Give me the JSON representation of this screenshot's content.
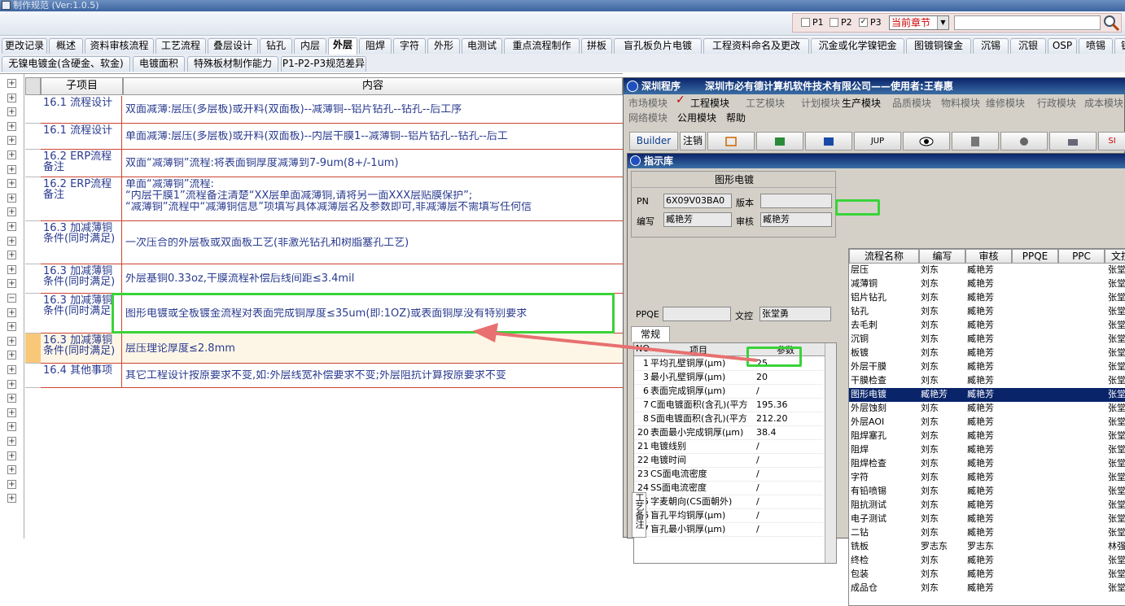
{
  "window": {
    "title": "制作规范 (Ver:1.0.5)"
  },
  "filter": {
    "p1": "P1",
    "p2": "P2",
    "p3": "P3",
    "p3_checked": "✓",
    "chapter_select": "当前章节",
    "search_value": ""
  },
  "tabs_row1": [
    "更改记录",
    "概述",
    "资料审核流程",
    "工艺流程",
    "叠层设计",
    "钻孔",
    "内层",
    "外层",
    "阻焊",
    "字符",
    "外形",
    "电测试",
    "重点流程制作",
    "拼板",
    "盲孔板负片电镀",
    "工程资料命名及更改",
    "沉金或化学镍钯金",
    "图镀铜镍金",
    "沉锡",
    "沉银",
    "OSP",
    "喷锡",
    "镀硬金"
  ],
  "active_tab": "外层",
  "tabs_row2": [
    "无镍电镀金(含硬金、软金)",
    "电镀面积",
    "特殊板材制作能力",
    "P1-P2-P3规范差异"
  ],
  "grid": {
    "col_item": "子项目",
    "col_content": "内容",
    "rows": [
      {
        "item": "16.1 流程设计",
        "content": "双面减薄:层压(多层板)或开料(双面板)--减薄铜--铝片钻孔--钻孔--后工序"
      },
      {
        "item": "16.1 流程设计",
        "content": "单面减薄:层压(多层板)或开料(双面板)--内层干膜1--减薄铜--铝片钻孔--钻孔--后工"
      },
      {
        "item": "16.2 ERP流程备注",
        "content": "双面“减薄铜”流程:将表面铜厚度减薄到7-9um(8+/-1um)"
      },
      {
        "item": "16.2 ERP流程备注",
        "content": "单面“减薄铜”流程:",
        "content2": "“内层干膜1”流程备注清楚“XX层单面减薄铜,请将另一面XXX层贴膜保护”;",
        "content3": "“减薄铜”流程中“减薄铜信息”项填写具体减薄层名及参数即可,非减薄层不需填写任何信"
      },
      {
        "item": "16.3 加减薄铜条件(同时满足)",
        "content": "一次压合的外层板或双面板工艺(非激光钻孔和树脂塞孔工艺)"
      },
      {
        "item": "16.3 加减薄铜条件(同时满足)",
        "content": "外层基铜0.33oz,干膜流程补偿后线间距≤3.4mil"
      },
      {
        "item": "16.3 加减薄铜条件(同时满足)",
        "content": "图形电镀或全板镀金流程对表面完成铜厚度≤35um(即:1OZ)或表面铜厚没有特别要求"
      },
      {
        "item": "16.3 加减薄铜条件(同时满足)",
        "content": "层压理论厚度≤2.8mm"
      },
      {
        "item": "16.4 其他事项",
        "content": "其它工程设计按原要求不变,如:外层线宽补偿要求不变;外层阻抗计算按原要求不变"
      }
    ]
  },
  "app": {
    "title": "深圳程序",
    "company": "深圳市必有德计算机软件技术有限公司——使用者:王春惠",
    "menu1": [
      "市场模块",
      "工程模块",
      "工艺模块",
      "计划模块",
      "生产模块",
      "品质模块",
      "物料模块",
      "维修模块",
      "行政模块",
      "成本模块"
    ],
    "menu2": [
      "网络模块",
      "公用模块",
      "帮助"
    ],
    "buttons": [
      "Builder",
      "注销",
      "JUP",
      "SI"
    ]
  },
  "indicator": {
    "title": "指示库",
    "group": "图形电镀",
    "pn_label": "PN",
    "pn": "6X09V03BA0",
    "version_label": "版本",
    "version": "",
    "author_label": "编写",
    "author": "臧艳芳",
    "review_label": "审核",
    "reviewer": "臧艳芳",
    "ppqe_label": "PPQE",
    "ppqe": "",
    "doc_label": "文控",
    "doc": "张堂勇",
    "tab": "常规",
    "param_headers": [
      "NO",
      "项目",
      "参数"
    ],
    "params": [
      {
        "no": "1",
        "item": "平均孔壁铜厚(μm)",
        "val": "25"
      },
      {
        "no": "3",
        "item": "最小孔壁铜厚(μm)",
        "val": "20"
      },
      {
        "no": "6",
        "item": "表面完成铜厚(μm)",
        "val": "/"
      },
      {
        "no": "7",
        "item": "C面电镀面积(含孔)(平方",
        "val": "195.36"
      },
      {
        "no": "8",
        "item": "S面电镀面积(含孔)(平方",
        "val": "212.20"
      },
      {
        "no": "20",
        "item": "表面最小完成铜厚(μm)",
        "val": "38.4"
      },
      {
        "no": "21",
        "item": "电镀线别",
        "val": "/"
      },
      {
        "no": "22",
        "item": "电镀时间",
        "val": "/"
      },
      {
        "no": "23",
        "item": "CS面电流密度",
        "val": "/"
      },
      {
        "no": "24",
        "item": "SS面电流密度",
        "val": "/"
      },
      {
        "no": "25",
        "item": "字麦朝向(CS面朝外)",
        "val": "/"
      },
      {
        "no": "26",
        "item": "盲孔平均铜厚(μm)",
        "val": "/"
      },
      {
        "no": "27",
        "item": "盲孔最小铜厚(μm)",
        "val": "/"
      }
    ],
    "side_label": "工艺备注",
    "flow_headers": [
      "流程名称",
      "编写",
      "审核",
      "PPQE",
      "PPC",
      "文控"
    ],
    "flows": [
      {
        "n": "层压",
        "a": "刘东",
        "r": "臧艳芳",
        "d": "张堂"
      },
      {
        "n": "减薄铜",
        "a": "刘东",
        "r": "臧艳芳",
        "d": "张堂"
      },
      {
        "n": "铝片钻孔",
        "a": "刘东",
        "r": "臧艳芳",
        "d": "张堂"
      },
      {
        "n": "钻孔",
        "a": "刘东",
        "r": "臧艳芳",
        "d": "张堂"
      },
      {
        "n": "去毛刺",
        "a": "刘东",
        "r": "臧艳芳",
        "d": "张堂"
      },
      {
        "n": "沉铜",
        "a": "刘东",
        "r": "臧艳芳",
        "d": "张堂"
      },
      {
        "n": "板镀",
        "a": "刘东",
        "r": "臧艳芳",
        "d": "张堂"
      },
      {
        "n": "外层干膜",
        "a": "刘东",
        "r": "臧艳芳",
        "d": "张堂"
      },
      {
        "n": "干膜检查",
        "a": "刘东",
        "r": "臧艳芳",
        "d": "张堂"
      },
      {
        "n": "图形电镀",
        "a": "臧艳芳",
        "r": "臧艳芳",
        "d": "张堂"
      },
      {
        "n": "外层蚀刻",
        "a": "刘东",
        "r": "臧艳芳",
        "d": "张堂"
      },
      {
        "n": "外层AOI",
        "a": "刘东",
        "r": "臧艳芳",
        "d": "张堂"
      },
      {
        "n": "阻焊塞孔",
        "a": "刘东",
        "r": "臧艳芳",
        "d": "张堂"
      },
      {
        "n": "阻焊",
        "a": "刘东",
        "r": "臧艳芳",
        "d": "张堂"
      },
      {
        "n": "阻焊检查",
        "a": "刘东",
        "r": "臧艳芳",
        "d": "张堂"
      },
      {
        "n": "字符",
        "a": "刘东",
        "r": "臧艳芳",
        "d": "张堂"
      },
      {
        "n": "有铅喷锡",
        "a": "刘东",
        "r": "臧艳芳",
        "d": "张堂"
      },
      {
        "n": "阻抗测试",
        "a": "刘东",
        "r": "臧艳芳",
        "d": "张堂"
      },
      {
        "n": "电子测试",
        "a": "刘东",
        "r": "臧艳芳",
        "d": "张堂"
      },
      {
        "n": "二钻",
        "a": "刘东",
        "r": "臧艳芳",
        "d": "张堂"
      },
      {
        "n": "铣板",
        "a": "罗志东",
        "r": "罗志东",
        "d": "林强"
      },
      {
        "n": "终检",
        "a": "刘东",
        "r": "臧艳芳",
        "d": "张堂"
      },
      {
        "n": "包装",
        "a": "刘东",
        "r": "臧艳芳",
        "d": "张堂"
      },
      {
        "n": "成品仓",
        "a": "刘东",
        "r": "臧艳芳",
        "d": "张堂"
      }
    ]
  }
}
